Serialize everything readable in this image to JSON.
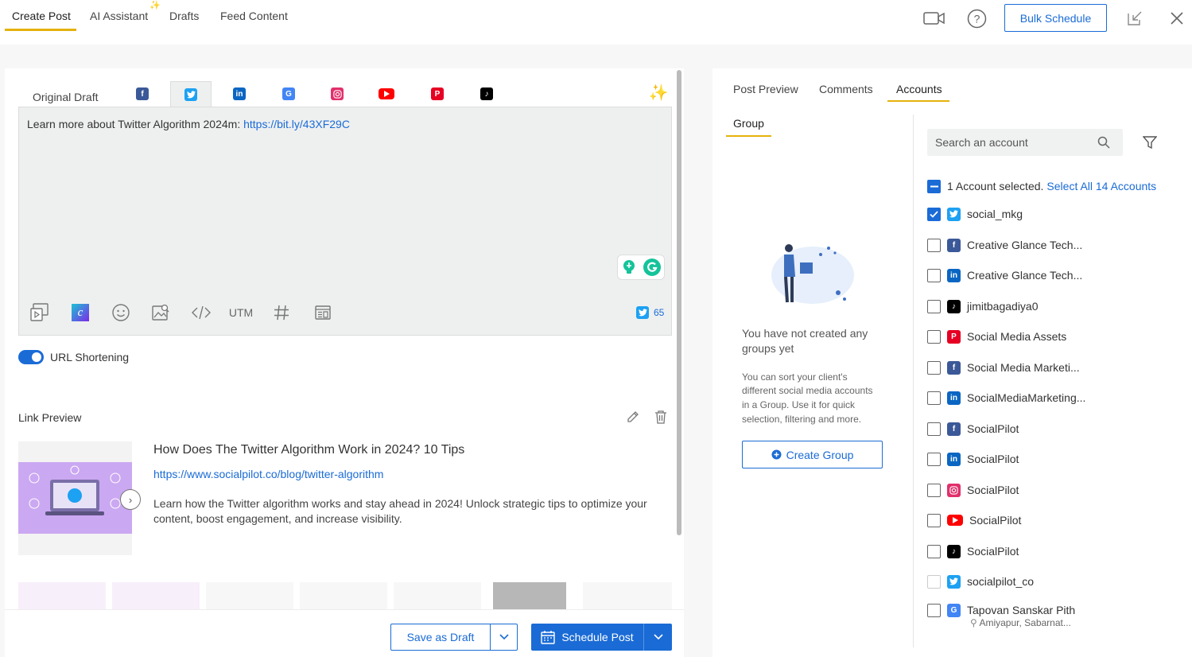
{
  "topbar": {
    "tabs": [
      "Create Post",
      "AI Assistant",
      "Drafts",
      "Feed Content"
    ],
    "bulk_schedule": "Bulk Schedule"
  },
  "editor": {
    "original_tab": "Original Draft",
    "networks": [
      "facebook-icon",
      "twitter-icon",
      "linkedin-icon",
      "google-business-icon",
      "instagram-icon",
      "youtube-icon",
      "pinterest-icon",
      "tiktok-icon"
    ],
    "text_prefix": "Learn more about Twitter Algorithm 2024m: ",
    "text_link": "https://bit.ly/43XF29C",
    "utm_label": "UTM",
    "char_count": "65",
    "url_shortening": "URL Shortening",
    "link_preview_label": "Link Preview",
    "link": {
      "title": "How Does The Twitter Algorithm Work in 2024? 10 Tips",
      "url": "https://www.socialpilot.co/blog/twitter-algorithm",
      "description_line1": "Learn how the Twitter algorithm works and stay ahead in 2024! Unlock strategic tips to optimize your",
      "description_line2": "content, boost engagement, and increase visibility."
    },
    "save_draft": "Save as Draft",
    "schedule_post": "Schedule Post"
  },
  "right": {
    "tabs": [
      "Post Preview",
      "Comments",
      "Accounts"
    ],
    "group_tab": "Group",
    "empty_title_1": "You have not created any",
    "empty_title_2": "groups yet",
    "empty_desc": [
      "You can sort your client's",
      "different social media accounts",
      "in a Group. Use it for quick",
      "selection, filtering and more."
    ],
    "create_group": "Create Group",
    "search_placeholder": "Search an account",
    "selected_text": "1 Account selected.",
    "select_all": "Select All 14 Accounts",
    "accounts": [
      {
        "name": "social_mkg",
        "net": "twitter",
        "checked": true
      },
      {
        "name": "Creative Glance Tech...",
        "net": "facebook"
      },
      {
        "name": "Creative Glance Tech...",
        "net": "linkedin"
      },
      {
        "name": "jimitbagadiya0",
        "net": "tiktok"
      },
      {
        "name": "Social Media Assets",
        "net": "pinterest"
      },
      {
        "name": "Social Media Marketi...",
        "net": "facebook"
      },
      {
        "name": "SocialMediaMarketing...",
        "net": "linkedin"
      },
      {
        "name": "SocialPilot",
        "net": "facebook"
      },
      {
        "name": "SocialPilot",
        "net": "linkedin"
      },
      {
        "name": "SocialPilot",
        "net": "instagram"
      },
      {
        "name": "SocialPilot",
        "net": "youtube"
      },
      {
        "name": "SocialPilot",
        "net": "tiktok"
      },
      {
        "name": "socialpilot_co",
        "net": "twitter",
        "disabled": true
      },
      {
        "name": "Tapovan Sanskar Pith",
        "net": "google",
        "sub": "Amiyapur, Sabarnat..."
      }
    ]
  },
  "colors": {
    "accent": "#1a6bd6",
    "underline": "#e5b20a",
    "facebook": "#3b5998",
    "twitter": "#1da1f2",
    "linkedin": "#0a66c2",
    "instagram": "#e1306c",
    "youtube": "#ff0000",
    "pinterest": "#e60023",
    "tiktok": "#000000",
    "google": "#4285f4"
  }
}
